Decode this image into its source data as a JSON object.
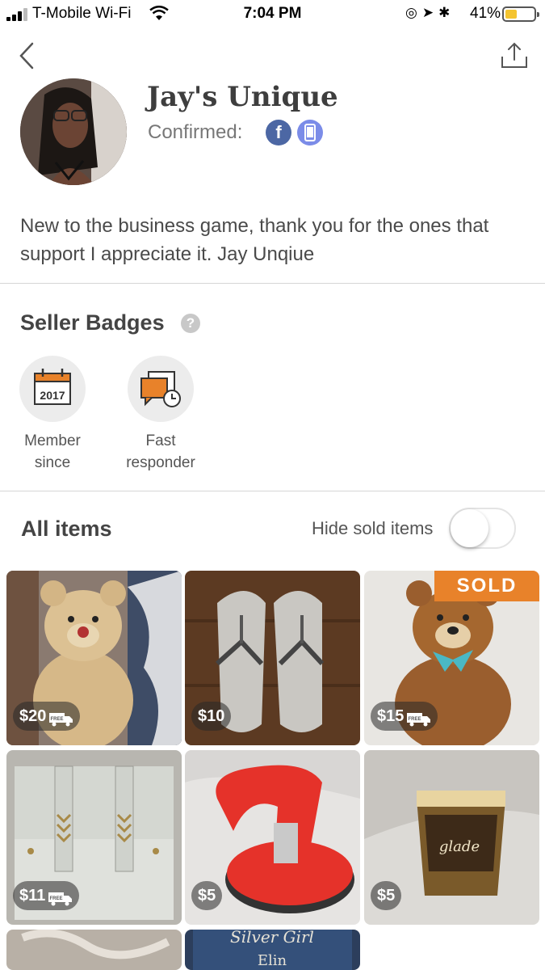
{
  "status_bar": {
    "carrier": "T-Mobile Wi-Fi",
    "time": "7:04 PM",
    "battery_percent": "41%",
    "battery_level": 0.41
  },
  "profile": {
    "name": "Jay's Unique",
    "confirmed_label": "Confirmed:",
    "facebook_glyph": "f",
    "bio": "New to the business game, thank you for the ones that support I appreciate it. Jay Unqiue"
  },
  "badges": {
    "title": "Seller Badges",
    "help_glyph": "?",
    "items": [
      {
        "icon": "calendar-icon",
        "year": "2017",
        "label": "Member since"
      },
      {
        "icon": "chat-clock-icon",
        "label": "Fast responder"
      }
    ]
  },
  "items_section": {
    "title": "All items",
    "hide_sold_label": "Hide sold items",
    "hide_sold_on": false,
    "free_shipping_text": "FREE",
    "sold_label": "SOLD",
    "items": [
      {
        "price": "$20",
        "free_shipping": true,
        "sold": false
      },
      {
        "price": "$10",
        "free_shipping": false,
        "sold": false
      },
      {
        "price": "$15",
        "free_shipping": true,
        "sold": true
      },
      {
        "price": "$11",
        "free_shipping": true,
        "sold": false
      },
      {
        "price": "$5",
        "free_shipping": false,
        "sold": false
      },
      {
        "price": "$5",
        "free_shipping": false,
        "sold": false
      }
    ],
    "partial_item_text": "Silver Girl",
    "partial_item_subtext": "Elin"
  },
  "colors": {
    "accent_orange": "#e8822a",
    "facebook_blue": "#4c67a4",
    "phone_badge": "#7b8ce8"
  }
}
